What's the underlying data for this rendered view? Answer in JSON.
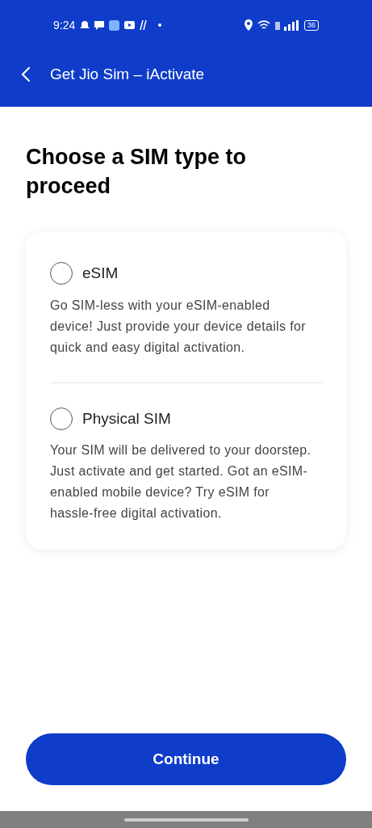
{
  "status_bar": {
    "time": "9:24",
    "battery": "36"
  },
  "app_bar": {
    "title": "Get Jio Sim – iActivate"
  },
  "heading": "Choose a SIM type to proceed",
  "options": [
    {
      "label": "eSIM",
      "description": "Go SIM-less with your eSIM-enabled device! Just provide your device details for quick and easy digital activation.",
      "selected": false
    },
    {
      "label": "Physical SIM",
      "description": "Your SIM will be delivered to your doorstep. Just activate and get started. Got an eSIM-enabled mobile device? Try eSIM for hassle-free digital activation.",
      "selected": false
    }
  ],
  "button": "Continue"
}
